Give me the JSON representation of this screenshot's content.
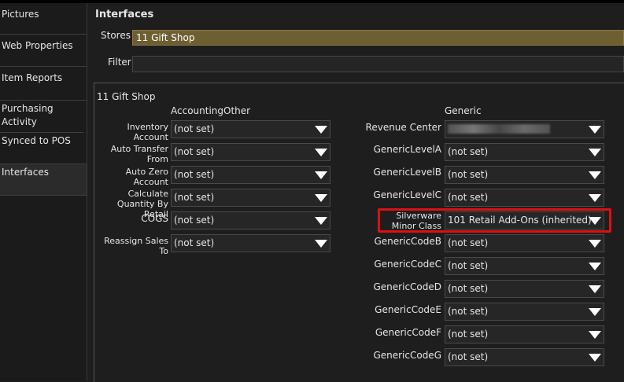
{
  "sidebar": {
    "items": [
      {
        "id": "pictures",
        "label": "Pictures"
      },
      {
        "id": "web-properties",
        "label": "Web Properties"
      },
      {
        "id": "item-reports",
        "label": "Item Reports"
      },
      {
        "id": "purchasing-activity",
        "label": "Purchasing Activity"
      },
      {
        "id": "synced-to-pos",
        "label": "Synced to POS"
      },
      {
        "id": "interfaces",
        "label": "Interfaces"
      }
    ],
    "active": "Interfaces"
  },
  "header": {
    "title": "Interfaces"
  },
  "stores": {
    "label": "Stores",
    "value": "11 Gift Shop"
  },
  "filter": {
    "label": "Filter",
    "value": ""
  },
  "panel": {
    "title": "11 Gift Shop",
    "left_heading": "AccountingOther",
    "right_heading": "Generic",
    "left_rows": [
      {
        "label": "Inventory Account",
        "value": "(not set)"
      },
      {
        "label": "Auto Transfer From",
        "value": "(not set)"
      },
      {
        "label": "Auto Zero Account",
        "value": "(not set)"
      },
      {
        "label": "Calculate Quantity By Retail",
        "value": "(not set)"
      },
      {
        "label": "COGS",
        "value": "(not set)"
      },
      {
        "label": "Reassign Sales To",
        "value": "(not set)"
      }
    ],
    "right_rows": [
      {
        "label": "Revenue Center",
        "value": ""
      },
      {
        "label": "GenericLevelA",
        "value": "(not set)"
      },
      {
        "label": "GenericLevelB",
        "value": "(not set)"
      },
      {
        "label": "GenericLevelC",
        "value": "(not set)"
      },
      {
        "label": "Silverware Minor Class",
        "value": "101 Retail Add-Ons (inherited)"
      },
      {
        "label": "GenericCodeB",
        "value": "(not set)"
      },
      {
        "label": "GenericCodeC",
        "value": "(not set)"
      },
      {
        "label": "GenericCodeD",
        "value": "(not set)"
      },
      {
        "label": "GenericCodeE",
        "value": "(not set)"
      },
      {
        "label": "GenericCodeF",
        "value": "(not set)"
      },
      {
        "label": "GenericCodeG",
        "value": "(not set)"
      }
    ]
  },
  "colors": {
    "stores_bg": "#6e5f33",
    "highlight": "#dd1111",
    "background": "#1e1e1e"
  }
}
